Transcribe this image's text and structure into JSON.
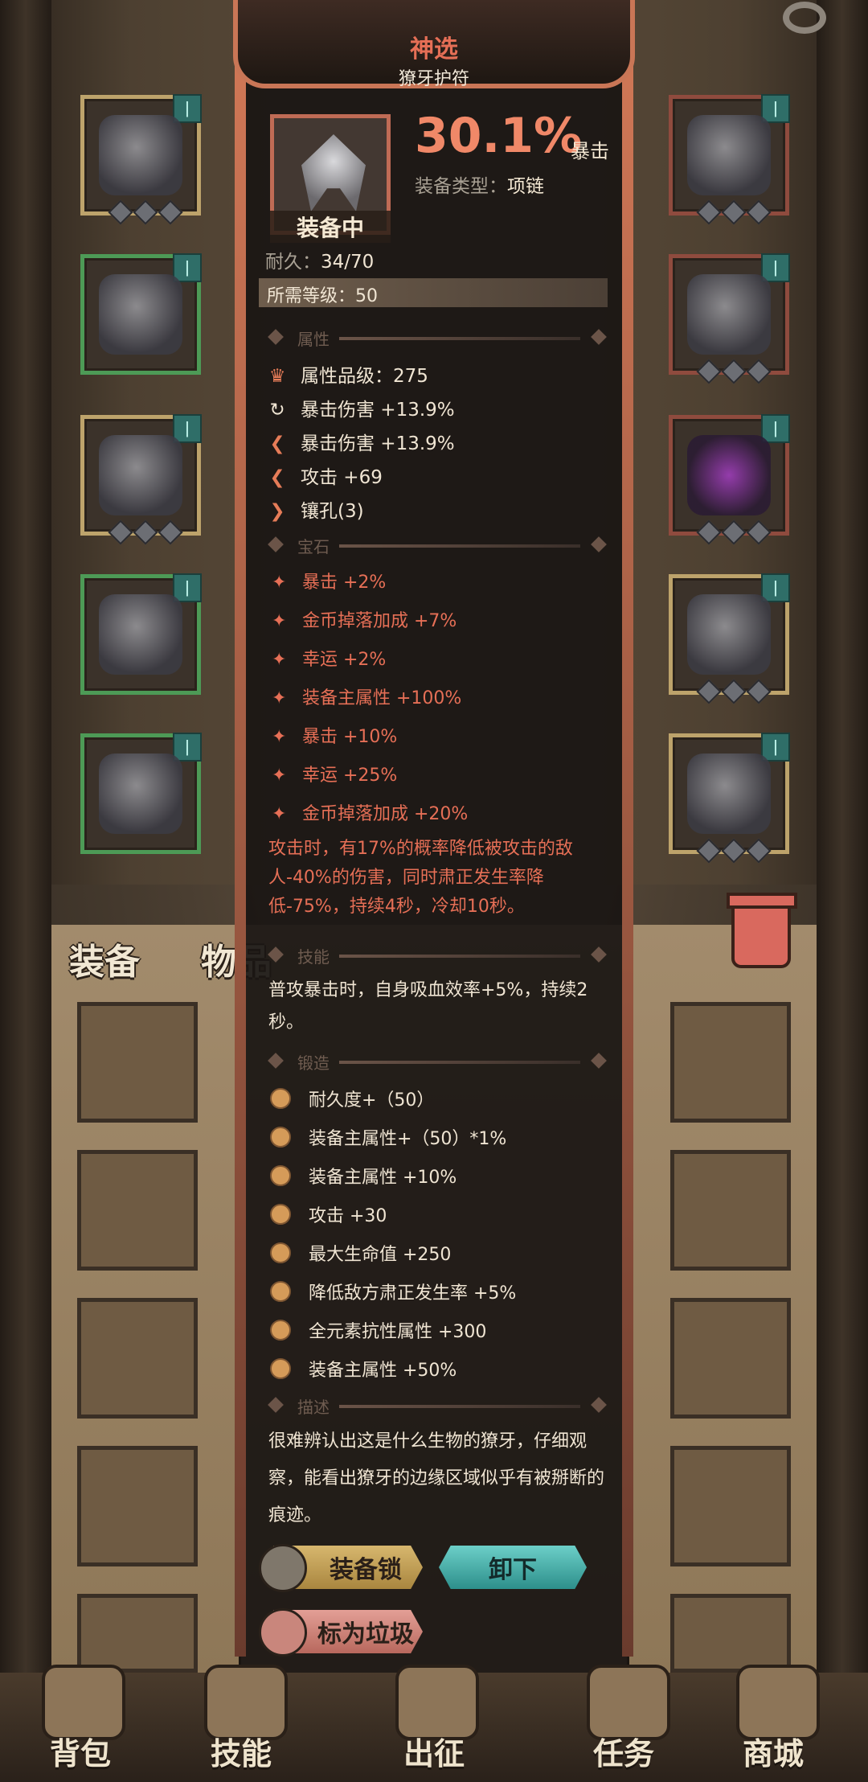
{
  "popup": {
    "rarity": "神选",
    "item_name": "獠牙护符",
    "equipped_label": "装备中",
    "crit_value": "30.1%",
    "crit_label": "暴击",
    "type_label": "装备类型：",
    "type_value": "项链",
    "durability_label": "耐久：",
    "durability_value": "34/70",
    "required_level": "所需等级：50",
    "sections": {
      "attributes": "属性",
      "gems": "宝石",
      "skills": "技能",
      "forge": "锻造",
      "description": "描述"
    },
    "attributes": [
      {
        "icon": "crown-icon",
        "text": "属性品级：275"
      },
      {
        "icon": "cycle-icon",
        "text": "暴击伤害 +13.9%"
      },
      {
        "icon": "arrow-icon",
        "text": "暴击伤害 +13.9%"
      },
      {
        "icon": "arrow-icon",
        "text": "攻击 +69"
      },
      {
        "icon": "arrow-icon",
        "text": "镶孔(3)"
      }
    ],
    "gems": [
      "暴击 +2%",
      "金币掉落加成 +7%",
      "幸运 +2%",
      "装备主属性 +100%",
      "暴击 +10%",
      "幸运 +25%",
      "金币掉落加成 +20%"
    ],
    "gem_effect": "攻击时，有17%的概率降低被攻击的敌人-40%的伤害，同时肃正发生率降低-75%，持续4秒，冷却10秒。",
    "skill_text": "普攻暴击时，自身吸血效率+5%，持续2秒。",
    "forge": [
      "耐久度+（50）",
      "装备主属性+（50）*1%",
      "装备主属性 +10%",
      "攻击 +30",
      "最大生命值 +250",
      "降低敌方肃正发生率 +5%",
      "全元素抗性属性 +300",
      "装备主属性 +50%"
    ],
    "description": "很难辨认出这是什么生物的獠牙，仔细观察，能看出獠牙的边缘区域似乎有被掰断的痕迹。",
    "buttons": {
      "lock": "装备锁",
      "unequip": "卸下",
      "mark_trash": "标为垃圾"
    }
  },
  "inventory_tabs": {
    "equipment": "装备",
    "items": "物品"
  },
  "bottom_nav": [
    "背包",
    "技能",
    "出征",
    "任务",
    "商城"
  ]
}
